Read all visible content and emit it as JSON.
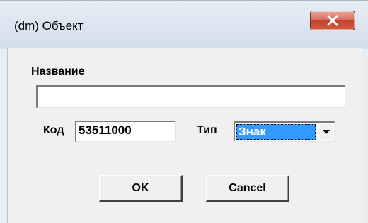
{
  "window": {
    "title": "(dm) Объект"
  },
  "form": {
    "name_label": "Название",
    "name_value": "",
    "code_label": "Код",
    "code_value": "53511000",
    "type_label": "Тип",
    "type_value": "Знак"
  },
  "buttons": {
    "ok_label": "OK",
    "cancel_label": "Cancel"
  },
  "colors": {
    "selection": "#3399ff",
    "close_button": "#c3422c",
    "dialog_bg": "#f0f0f0"
  }
}
